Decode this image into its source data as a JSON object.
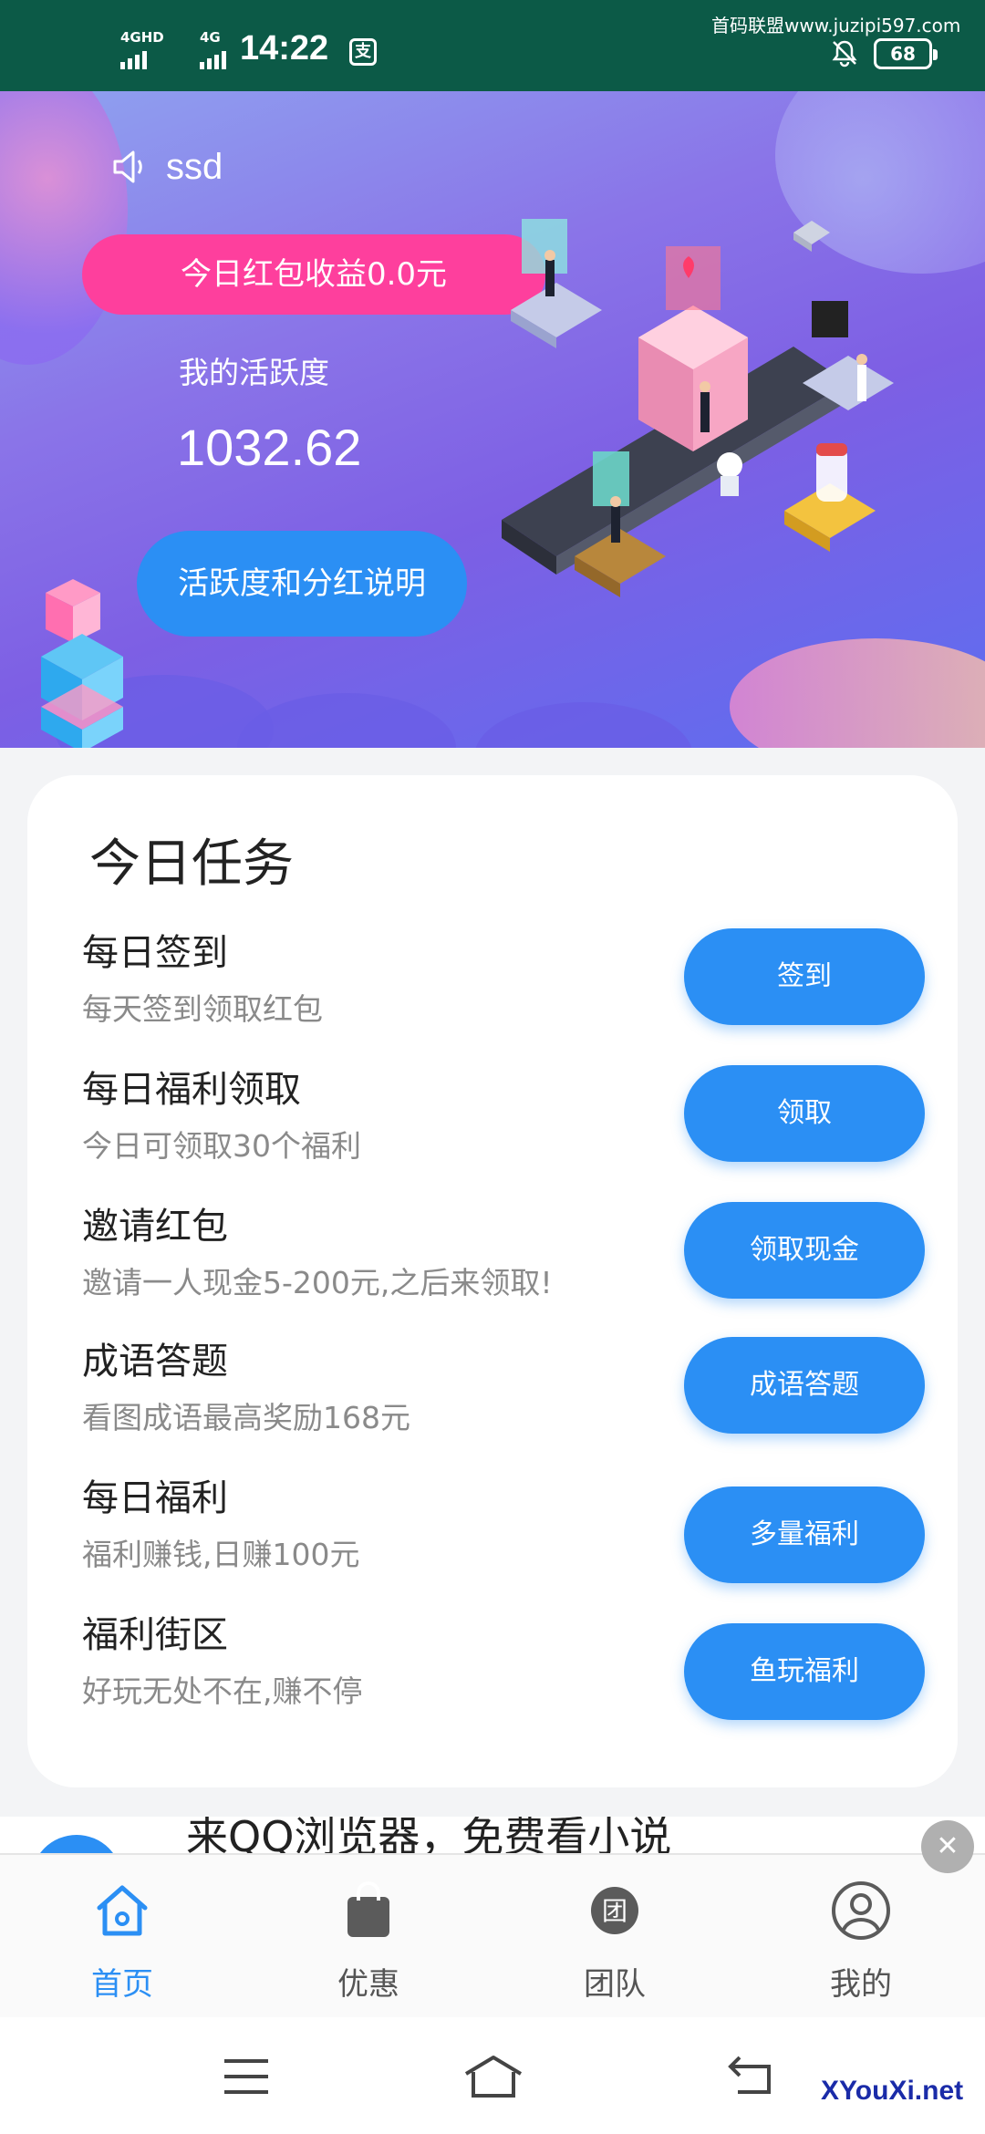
{
  "status_bar": {
    "network1": "4GHD",
    "network2": "4G",
    "time": "14:22",
    "app_icon": "支",
    "watermark": "首码联盟www.juzipi597.com",
    "battery": "68"
  },
  "hero": {
    "user": "ssd",
    "today_red_packet": "今日红包收益0.0元",
    "activity_label": "我的活跃度",
    "activity_value": "1032.62",
    "explain_button": "活跃度和分红说明"
  },
  "tasks": {
    "title": "今日任务",
    "items": [
      {
        "name": "每日签到",
        "desc": "每天签到领取红包",
        "button": "签到"
      },
      {
        "name": "每日福利领取",
        "desc": "今日可领取30个福利",
        "button": "领取"
      },
      {
        "name": "邀请红包",
        "desc": "邀请一人现金5-200元,之后来领取!",
        "button": "领取现金"
      },
      {
        "name": "成语答题",
        "desc": "看图成语最高奖励168元",
        "button": "成语答题"
      },
      {
        "name": "每日福利",
        "desc": "福利赚钱,日赚100元",
        "button": "多量福利"
      },
      {
        "name": "福利街区",
        "desc": "好玩无处不在,赚不停",
        "button": "鱼玩福利"
      }
    ]
  },
  "ad": {
    "text": "来QQ浏览器，免费看小说"
  },
  "bottom_nav": [
    {
      "label": "首页",
      "icon": "home-icon",
      "active": true
    },
    {
      "label": "优惠",
      "icon": "shopping-bag-icon",
      "active": false
    },
    {
      "label": "团队",
      "icon": "team-icon",
      "active": false
    },
    {
      "label": "我的",
      "icon": "profile-icon",
      "active": false
    }
  ],
  "nav_glyph_team": "团",
  "branding": "XYouXi.net",
  "colors": {
    "status_bar": "#0c5a47",
    "accent_blue": "#2b8ff4",
    "pink": "#fe3f9d"
  }
}
